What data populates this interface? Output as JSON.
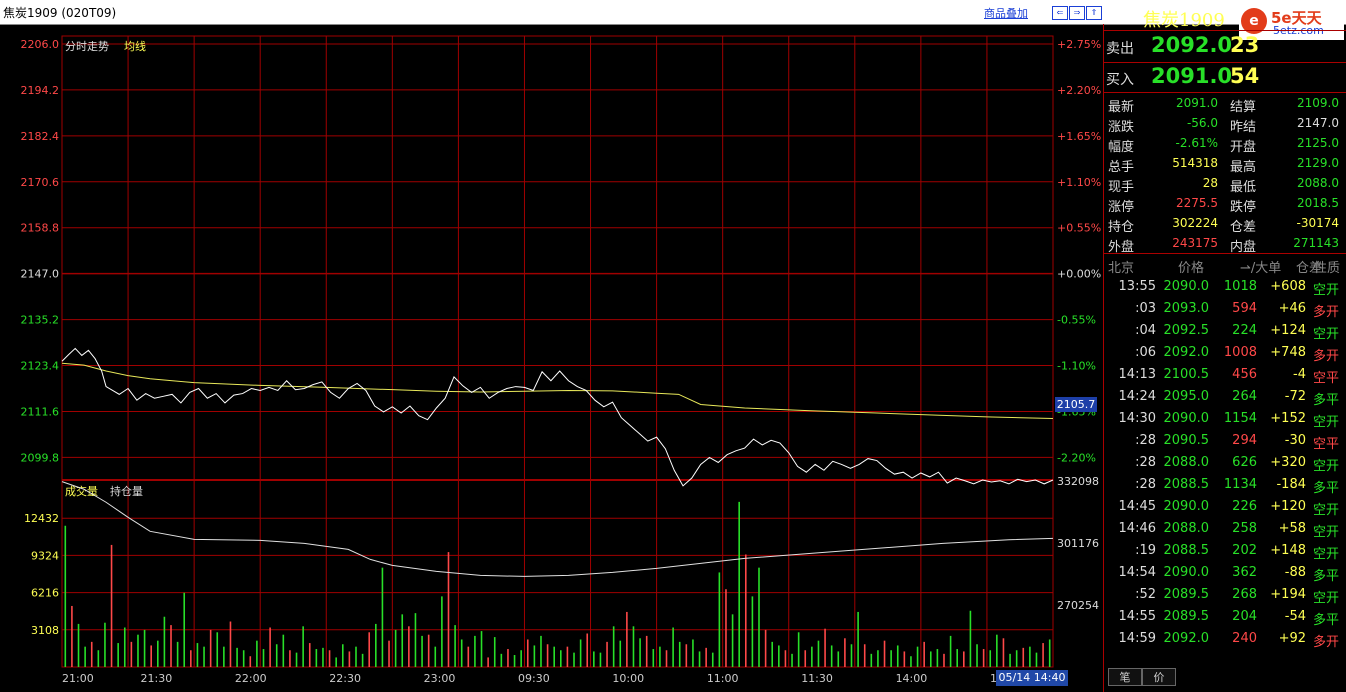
{
  "window": {
    "title": "焦炭1909 (020T09)",
    "overlay_link": "商品叠加",
    "nav": [
      "⇐",
      "⇒",
      "⇑"
    ]
  },
  "chart_data": {
    "type": "line",
    "title": "",
    "legend": [
      "分时走势",
      "均线"
    ],
    "xlabel": "",
    "ylabel": "",
    "prev_settle": 2147.0,
    "ylim": [
      2094.0,
      2206.0
    ],
    "y_ticks": [
      2206.0,
      2194.2,
      2182.4,
      2170.6,
      2158.8,
      2147.0,
      2135.2,
      2123.4,
      2111.6,
      2099.8
    ],
    "pct_ticks": [
      "+2.75%",
      "+2.20%",
      "+1.65%",
      "+1.10%",
      "+0.55%",
      "+0.00%",
      "-0.55%",
      "-1.10%",
      "-1.65%",
      "-2.20%"
    ],
    "x_ticks": [
      "21:00",
      "21:30",
      "22:00",
      "22:30",
      "23:00",
      "09:30",
      "10:00",
      "11:00",
      "11:30",
      "14:00",
      "14:30"
    ],
    "last_price_label": "2105.7",
    "price_series": {
      "name": "分时走势",
      "x": [
        0,
        3,
        6,
        9,
        12,
        15,
        18,
        20,
        23,
        26,
        30,
        34,
        38,
        42,
        46,
        50,
        54,
        58,
        62,
        66,
        70,
        74,
        78,
        82,
        86,
        90,
        94,
        98,
        102,
        106,
        110,
        114,
        118,
        122,
        126,
        130,
        134,
        138,
        142,
        146,
        150,
        154,
        158,
        162,
        166,
        170,
        174,
        178,
        182,
        186,
        190,
        194,
        198,
        202,
        206,
        210,
        214,
        218,
        222,
        226,
        230,
        234,
        238,
        242,
        246,
        250,
        254,
        258,
        262,
        266,
        270,
        274,
        278,
        282,
        286,
        290,
        294,
        298,
        302,
        306,
        310,
        314,
        318,
        322,
        326,
        330,
        334,
        338,
        342,
        346,
        350,
        354,
        358,
        362,
        366,
        370,
        374,
        378,
        382,
        386,
        390,
        394,
        398,
        402,
        406,
        410,
        414,
        418,
        422,
        426,
        430,
        434,
        438,
        442,
        446,
        450
      ],
      "values": [
        2124.5,
        2126.2,
        2127.8,
        2126.0,
        2127.3,
        2125.2,
        2122.0,
        2118.0,
        2117.0,
        2116.0,
        2117.5,
        2114.5,
        2116.2,
        2115.0,
        2115.5,
        2116.0,
        2113.8,
        2116.5,
        2117.5,
        2115.0,
        2116.2,
        2113.8,
        2115.8,
        2116.2,
        2117.5,
        2117.0,
        2117.8,
        2117.0,
        2119.5,
        2117.2,
        2117.5,
        2118.5,
        2119.2,
        2116.5,
        2115.0,
        2117.5,
        2118.8,
        2117.0,
        2113.0,
        2111.5,
        2112.8,
        2111.2,
        2113.0,
        2110.5,
        2109.5,
        2112.5,
        2115.0,
        2120.5,
        2118.2,
        2116.5,
        2117.8,
        2115.0,
        2116.5,
        2117.5,
        2118.0,
        2117.8,
        2117.0,
        2121.8,
        2119.5,
        2122.0,
        2119.5,
        2118.0,
        2117.0,
        2114.5,
        2112.8,
        2114.0,
        2110.0,
        2108.0,
        2106.0,
        2104.0,
        2105.0,
        2102.0,
        2096.5,
        2092.5,
        2094.5,
        2098.0,
        2099.8,
        2098.5,
        2100.5,
        2101.5,
        2102.2,
        2104.5,
        2103.0,
        2104.2,
        2103.5,
        2101.0,
        2097.5,
        2096.0,
        2098.0,
        2096.5,
        2098.8,
        2098.0,
        2097.0,
        2098.0,
        2099.5,
        2099.0,
        2097.0,
        2095.5,
        2096.0,
        2094.5,
        2095.8,
        2094.8,
        2096.0,
        2093.2,
        2094.5,
        2093.8,
        2093.0,
        2094.0,
        2093.5,
        2093.8,
        2093.0,
        2094.2,
        2093.6,
        2094.0,
        2093.0,
        2094.0
      ]
    },
    "avg_series": {
      "name": "均线",
      "x": [
        0,
        10,
        20,
        30,
        40,
        60,
        90,
        120,
        150,
        170,
        190,
        210,
        230,
        250,
        270,
        280,
        290,
        310,
        340,
        370,
        400,
        420,
        450
      ],
      "values": [
        2124.0,
        2123.5,
        2122.0,
        2120.8,
        2120.0,
        2119.0,
        2118.3,
        2117.8,
        2117.2,
        2116.8,
        2116.6,
        2116.8,
        2117.0,
        2116.9,
        2116.3,
        2116.0,
        2113.4,
        2112.5,
        2111.8,
        2111.2,
        2110.6,
        2110.2,
        2109.8
      ]
    },
    "x_total_minutes": 450,
    "volume_panel": {
      "legend": [
        "成交量",
        "持仓量"
      ],
      "ylim": [
        0,
        15540
      ],
      "y_ticks": [
        12432,
        9324,
        6216,
        3108
      ],
      "oi_ylim": [
        239332,
        332098
      ],
      "oi_ticks": [
        332098,
        301176,
        270254
      ],
      "oi_series": {
        "name": "持仓量",
        "x": [
          0,
          10,
          20,
          30,
          40,
          60,
          90,
          110,
          130,
          140,
          150,
          170,
          190,
          210,
          230,
          250,
          270,
          290,
          310,
          340,
          370,
          400,
          430,
          450
        ],
        "values": [
          331800,
          328000,
          321500,
          314000,
          307000,
          303000,
          302500,
          301000,
          298000,
          293000,
          290000,
          287000,
          285000,
          284500,
          285000,
          286500,
          288500,
          291000,
          293500,
          296000,
          298500,
          301000,
          302800,
          303500
        ]
      },
      "volume_bars": [
        11800,
        5100,
        3600,
        1700,
        2100,
        1400,
        3700,
        10200,
        2000,
        3300,
        2100,
        2700,
        3100,
        1800,
        2200,
        4200,
        3500,
        2100,
        6200,
        1400,
        2000,
        1700,
        3100,
        2900,
        1700,
        3800,
        1600,
        1400,
        900,
        2200,
        1500,
        3300,
        1900,
        2700,
        1400,
        1200,
        3400,
        2000,
        1500,
        1600,
        1400,
        800,
        1900,
        1300,
        1700,
        1100,
        2900,
        3600,
        8300,
        2200,
        3100,
        4400,
        3400,
        4500,
        2600,
        2700,
        1700,
        5900,
        9600,
        3500,
        2300,
        1700,
        2600,
        3000,
        800,
        2500,
        1100,
        1500,
        1000,
        1400,
        2300,
        1800,
        2600,
        1900,
        1700,
        1400,
        1700,
        1200,
        2300,
        2800,
        1300,
        1200,
        2100,
        3400,
        2200,
        4600,
        3400,
        2400,
        2600,
        1500,
        1700,
        1400,
        3300,
        2100,
        1900,
        2300,
        1300,
        1600,
        1200,
        7900,
        6500,
        4400,
        13800,
        9400,
        5900,
        8300,
        3100,
        2100,
        1800,
        1400,
        1100,
        2900,
        1400,
        1700,
        2200,
        3200,
        1800,
        1300,
        2400,
        1900,
        4600,
        1900,
        1100,
        1400,
        2200,
        1400,
        1800,
        1300,
        900,
        1700,
        2100,
        1300,
        1500,
        1100,
        2600,
        1500,
        1300,
        4700,
        1900,
        1500,
        1400,
        2700,
        2400,
        1100,
        1400,
        1600,
        1700,
        1200,
        2000,
        2300
      ]
    }
  },
  "time_box": "05/14 14:40",
  "quote": {
    "symbol": "焦炭1909",
    "sell_label": "卖出",
    "sell_price": "2092.0",
    "sell_vol": "23",
    "buy_label": "买入",
    "buy_price": "2091.0",
    "buy_vol": "54",
    "stats": [
      {
        "l1": "最新",
        "v1": "2091.0",
        "c1": "#28e028",
        "l2": "结算",
        "v2": "2109.0",
        "c2": "#28e028"
      },
      {
        "l1": "涨跌",
        "v1": "-56.0",
        "c1": "#28e028",
        "l2": "昨结",
        "v2": "2147.0",
        "c2": "#dddddd"
      },
      {
        "l1": "幅度",
        "v1": "-2.61%",
        "c1": "#28e028",
        "l2": "开盘",
        "v2": "2125.0",
        "c2": "#28e028"
      },
      {
        "l1": "总手",
        "v1": "514318",
        "c1": "#ffff54",
        "l2": "最高",
        "v2": "2129.0",
        "c2": "#28e028"
      },
      {
        "l1": "现手",
        "v1": "28",
        "c1": "#ffff54",
        "l2": "最低",
        "v2": "2088.0",
        "c2": "#28e028"
      },
      {
        "l1": "涨停",
        "v1": "2275.5",
        "c1": "#ff4848",
        "l2": "跌停",
        "v2": "2018.5",
        "c2": "#28e028"
      },
      {
        "l1": "持仓",
        "v1": "302224",
        "c1": "#ffff54",
        "l2": "仓差",
        "v2": "-30174",
        "c2": "#ffff54"
      },
      {
        "l1": "外盘",
        "v1": "243175",
        "c1": "#ff4848",
        "l2": "内盘",
        "v2": "271143",
        "c2": "#28e028"
      }
    ],
    "tick_headers": [
      "北京",
      "价格",
      "⇀/大单",
      "仓差",
      "性质"
    ],
    "ticks": [
      {
        "t": "13:55",
        "p": "2090.0",
        "v": "1018",
        "d": "+608",
        "n": "空开",
        "vc": "#28e028",
        "nc": "#28e028"
      },
      {
        "t": ":03",
        "p": "2093.0",
        "v": "594",
        "d": "+46",
        "n": "多开",
        "vc": "#ff4848",
        "nc": "#ff4848"
      },
      {
        "t": ":04",
        "p": "2092.5",
        "v": "224",
        "d": "+124",
        "n": "空开",
        "vc": "#28e028",
        "nc": "#28e028"
      },
      {
        "t": ":06",
        "p": "2092.0",
        "v": "1008",
        "d": "+748",
        "n": "多开",
        "vc": "#ff4848",
        "nc": "#ff4848"
      },
      {
        "t": "14:13",
        "p": "2100.5",
        "v": "456",
        "d": "-4",
        "n": "空平",
        "vc": "#ff4848",
        "nc": "#ff4848"
      },
      {
        "t": "14:24",
        "p": "2095.0",
        "v": "264",
        "d": "-72",
        "n": "多平",
        "vc": "#28e028",
        "nc": "#28e028"
      },
      {
        "t": "14:30",
        "p": "2090.0",
        "v": "1154",
        "d": "+152",
        "n": "空开",
        "vc": "#28e028",
        "nc": "#28e028"
      },
      {
        "t": ":28",
        "p": "2090.5",
        "v": "294",
        "d": "-30",
        "n": "空平",
        "vc": "#ff4848",
        "nc": "#ff4848"
      },
      {
        "t": ":28",
        "p": "2088.0",
        "v": "626",
        "d": "+320",
        "n": "空开",
        "vc": "#28e028",
        "nc": "#28e028"
      },
      {
        "t": ":28",
        "p": "2088.5",
        "v": "1134",
        "d": "-184",
        "n": "多平",
        "vc": "#28e028",
        "nc": "#28e028"
      },
      {
        "t": "14:45",
        "p": "2090.0",
        "v": "226",
        "d": "+120",
        "n": "空开",
        "vc": "#28e028",
        "nc": "#28e028"
      },
      {
        "t": "14:46",
        "p": "2088.0",
        "v": "258",
        "d": "+58",
        "n": "空开",
        "vc": "#28e028",
        "nc": "#28e028"
      },
      {
        "t": ":19",
        "p": "2088.5",
        "v": "202",
        "d": "+148",
        "n": "空开",
        "vc": "#28e028",
        "nc": "#28e028"
      },
      {
        "t": "14:54",
        "p": "2090.0",
        "v": "362",
        "d": "-88",
        "n": "多平",
        "vc": "#28e028",
        "nc": "#28e028"
      },
      {
        "t": ":52",
        "p": "2089.5",
        "v": "268",
        "d": "+194",
        "n": "空开",
        "vc": "#28e028",
        "nc": "#28e028"
      },
      {
        "t": "14:55",
        "p": "2089.5",
        "v": "204",
        "d": "-54",
        "n": "多平",
        "vc": "#28e028",
        "nc": "#28e028"
      },
      {
        "t": "14:59",
        "p": "2092.0",
        "v": "240",
        "d": "+92",
        "n": "多开",
        "vc": "#ff4848",
        "nc": "#ff4848"
      }
    ],
    "tabs": [
      "笔",
      "价"
    ]
  },
  "logo": {
    "main": "5e天天",
    "sub": "5etz.com"
  },
  "colors": {
    "up": "#ff4848",
    "down": "#28e028",
    "grid": "#a00000",
    "vol": "#ffff54"
  }
}
